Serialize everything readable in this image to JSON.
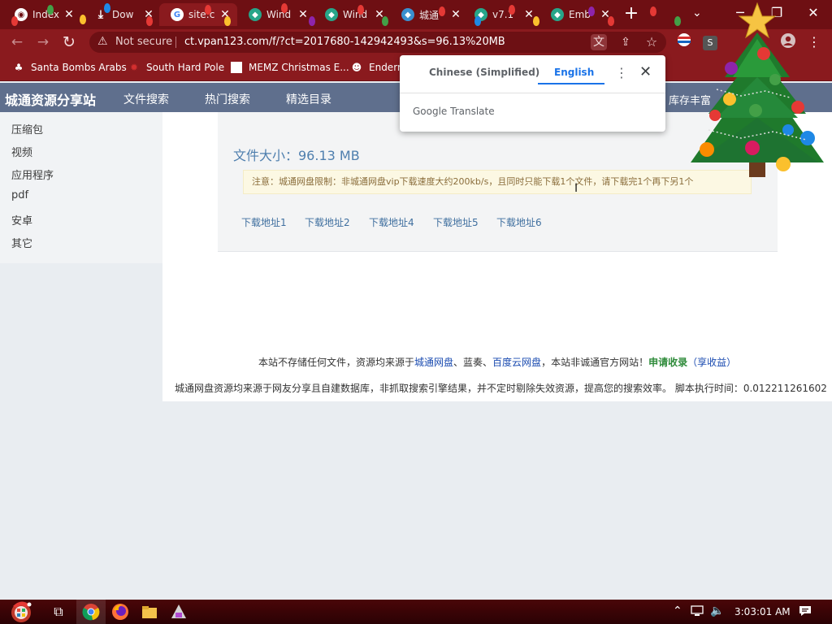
{
  "browser": {
    "tabs": [
      {
        "label": "Index",
        "active": false
      },
      {
        "label": "Dow",
        "active": false
      },
      {
        "label": "site:c",
        "active": true
      },
      {
        "label": "Wind",
        "active": false
      },
      {
        "label": "Wind",
        "active": false
      },
      {
        "label": "城通",
        "active": false
      },
      {
        "label": "v7.1",
        "active": false
      },
      {
        "label": "Emb",
        "active": false
      }
    ],
    "tab_close": "✕",
    "new_tab": "+",
    "nav": {
      "back": "←",
      "forward": "→",
      "reload": "↻"
    },
    "omnibox": {
      "security_label": "Not secure",
      "url": "ct.vpan123.com/f/?ct=2017680-142942493&s=96.13%20MB"
    },
    "profile_badge": "S"
  },
  "bookmarks": [
    {
      "label": "Santa Bombs Arabs"
    },
    {
      "label": "South Hard Pole"
    },
    {
      "label": "MEMZ Christmas E..."
    },
    {
      "label": "Enderm"
    }
  ],
  "translate_popup": {
    "source_lang": "Chinese (Simplified)",
    "target_lang": "English",
    "brand": "Google Translate"
  },
  "site": {
    "logo": "城通资源分享站",
    "nav": [
      "文件搜索",
      "热门搜索",
      "精选目录"
    ],
    "nav_right": "库存丰富",
    "sidebar": [
      "压缩包",
      "视频",
      "应用程序",
      "pdf",
      "安卓",
      "其它"
    ],
    "file_size": "文件大小：96.13 MB",
    "notice": "注意：城通网盘限制：非城通网盘vip下载速度大约200kb/s，且同时只能下载1个文件，请下载完1个再下另1个",
    "download_links": [
      "下载地址1",
      "下载地址2",
      "下载地址4",
      "下载地址5",
      "下载地址6"
    ],
    "footer": {
      "line1_a": "本站不存储任何文件，资源均来源于",
      "link_ctfile": "城通网盘",
      "sep1": "、蓝奏、",
      "link_baidu": "百度云网盘",
      "line1_b": "，本站非诚通官方网站！",
      "apply_link": "申请收录",
      "apply_paren": "（享收益）",
      "line2": "城通网盘资源均来源于网友分享且自建数据库，非抓取搜索引擎结果，并不定时剔除失效资源，提高您的搜索效率。 脚本执行时间：0.012211261602"
    }
  },
  "taskbar": {
    "clock": "3:03:01 AM"
  },
  "colors": {
    "tabstrip": "#6e0f13",
    "toolbar": "#8a1a1e",
    "site_header": "#5f6f8d",
    "link": "#3f6f9f",
    "notice_bg": "#fcf8e3",
    "translate_accent": "#1a73e8"
  }
}
